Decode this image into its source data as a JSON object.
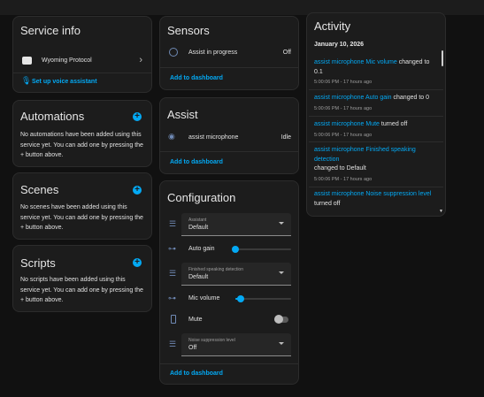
{
  "service_info": {
    "title": "Service info",
    "integration": "Wyoming Protocol",
    "setup_link": "Set up voice assistant"
  },
  "automations": {
    "title": "Automations",
    "text": "No automations have been added using this service yet. You can add one by pressing the + button above."
  },
  "scenes": {
    "title": "Scenes",
    "text": "No scenes have been added using this service yet. You can add one by pressing the + button above."
  },
  "scripts": {
    "title": "Scripts",
    "text": "No scripts have been added using this service yet. You can add one by pressing the + button above."
  },
  "sensors": {
    "title": "Sensors",
    "row_label": "Assist in progress",
    "row_state": "Off",
    "add_link": "Add to dashboard"
  },
  "assist": {
    "title": "Assist",
    "row_label": "assist microphone",
    "row_state": "Idle",
    "add_link": "Add to dashboard"
  },
  "configuration": {
    "title": "Configuration",
    "assistant_select": {
      "label": "Assistant",
      "value": "Default"
    },
    "auto_gain": {
      "label": "Auto gain",
      "value": 0
    },
    "finished_select": {
      "label": "Finished speaking detection",
      "value": "Default"
    },
    "mic_volume": {
      "label": "Mic volume",
      "value": 0.1
    },
    "mute": {
      "label": "Mute",
      "on": false
    },
    "noise_select": {
      "label": "Noise suppression level",
      "value": "Off"
    },
    "add_link": "Add to dashboard"
  },
  "activity": {
    "title": "Activity",
    "date": "January 10, 2026",
    "entries": [
      {
        "entity": "assist microphone Mic volume",
        "action": "changed to 0.1",
        "time": "5:00:06 PM - 17 hours ago"
      },
      {
        "entity": "assist microphone Auto gain",
        "action": "changed to 0",
        "time": "5:00:06 PM - 17 hours ago"
      },
      {
        "entity": "assist microphone Mute",
        "action": "turned off",
        "time": "5:00:06 PM - 17 hours ago"
      },
      {
        "entity": "assist microphone Finished speaking detection",
        "action": "changed to Default",
        "time": "5:00:06 PM - 17 hours ago"
      },
      {
        "entity": "assist microphone Noise suppression level",
        "action": "turned off",
        "time": ""
      }
    ]
  },
  "colors": {
    "accent": "#03a9f4",
    "card_bg": "#1c1c1c",
    "page_bg": "#111111",
    "icon": "#6f89b4"
  }
}
